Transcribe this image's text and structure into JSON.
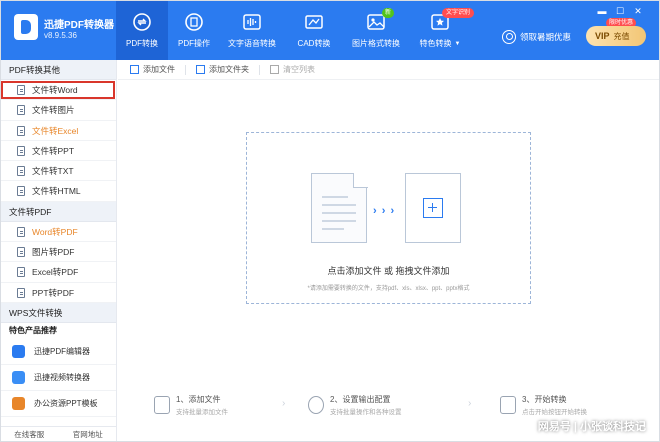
{
  "app": {
    "name": "迅捷PDF转换器",
    "version": "v8.9.5.36"
  },
  "nav": [
    {
      "label": "PDF转换",
      "icon": "convert-icon"
    },
    {
      "label": "PDF操作",
      "icon": "pdf-edit-icon"
    },
    {
      "label": "文字语音转换",
      "icon": "audio-wave-icon"
    },
    {
      "label": "CAD转换",
      "icon": "cad-icon"
    },
    {
      "label": "图片格式转换",
      "icon": "image-icon",
      "badge": "新"
    },
    {
      "label": "特色转换",
      "icon": "special-icon",
      "badge": "文字识别"
    }
  ],
  "header": {
    "summer_link": "领取暑期优惠",
    "vip_label": "VIP",
    "vip_sub": "充值",
    "vip_tag": "限时优惠",
    "win_controls": [
      "▬",
      "☐",
      "✕"
    ]
  },
  "sidebar": {
    "sections": [
      {
        "title": "PDF转换其他",
        "items": [
          "文件转Word",
          "文件转图片",
          "文件转Excel",
          "文件转PPT",
          "文件转TXT",
          "文件转HTML"
        ]
      },
      {
        "title": "文件转PDF",
        "items": [
          "Word转PDF",
          "图片转PDF",
          "Excel转PDF",
          "PPT转PDF"
        ]
      },
      {
        "title": "WPS文件转换",
        "items": []
      }
    ],
    "recommend_title": "特色产品推荐",
    "apps": [
      "迅捷PDF编辑器",
      "迅捷视频转换器",
      "办公资源PPT模板"
    ],
    "footer": [
      "在线客服",
      "官网地址"
    ]
  },
  "toolbar": {
    "add_file": "添加文件",
    "add_folder": "添加文件夹",
    "clear_list": "清空列表"
  },
  "dropzone": {
    "title": "点击添加文件 或 拖拽文件添加",
    "hint": "*请添加需要转换的文件，支持pdf、xls、xlsx、ppt、pptx格式",
    "arrows": "› › ›"
  },
  "steps": [
    {
      "title": "1、添加文件",
      "desc": "支持批量添加文件"
    },
    {
      "title": "2、设置输出配置",
      "desc": "支持批量操作和各种设置"
    },
    {
      "title": "3、开始转换",
      "desc": "点击开始按钮开始转换"
    }
  ],
  "watermark": "网易号 | 小张谈科技记",
  "colors": {
    "primary": "#2b7bf0",
    "accent_orange": "#e8862a",
    "selection_red": "#d9362b"
  }
}
